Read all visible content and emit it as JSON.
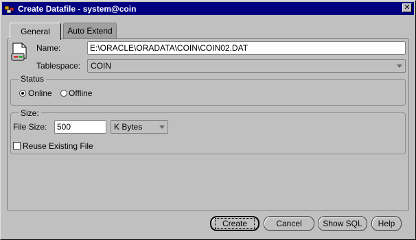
{
  "window": {
    "title": "Create Datafile - system@coin",
    "close_glyph": "✕"
  },
  "tabs": [
    {
      "label": "General",
      "active": true
    },
    {
      "label": "Auto Extend",
      "active": false
    }
  ],
  "general": {
    "name_label": "Name:",
    "name_value": "E:\\ORACLE\\ORADATA\\COIN\\COIN02.DAT",
    "tablespace_label": "Tablespace:",
    "tablespace_value": "COIN",
    "status": {
      "group_label": "Status",
      "online_label": "Online",
      "offline_label": "Offline",
      "selected": "Online"
    },
    "size": {
      "group_label": "Size:",
      "file_size_label": "File Size:",
      "file_size_value": "500",
      "unit_value": "K Bytes",
      "reuse_label": "Reuse Existing File",
      "reuse_checked": false
    }
  },
  "buttons": {
    "create": "Create",
    "cancel": "Cancel",
    "show_sql": "Show SQL",
    "help": "Help"
  },
  "icons": {
    "app": "oracle-app-icon",
    "datafile": "datafile-document-icon"
  }
}
